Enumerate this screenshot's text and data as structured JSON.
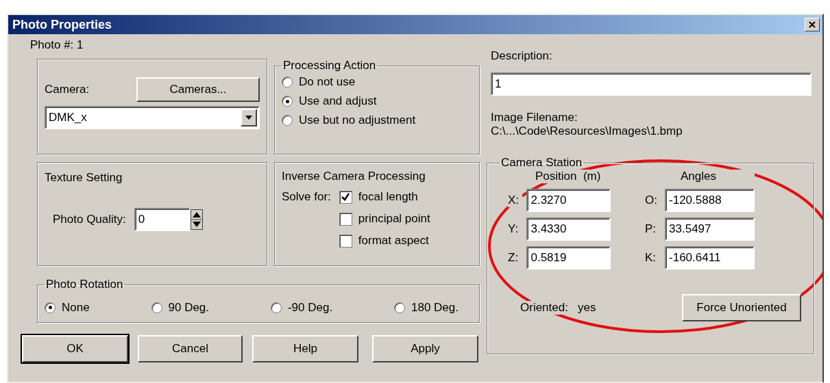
{
  "window": {
    "title": "Photo Properties"
  },
  "photo_number": "Photo #: 1",
  "camera": {
    "label": "Camera:",
    "button": "Cameras...",
    "value": "DMK_x"
  },
  "processing_action": {
    "title": "Processing Action",
    "options": [
      {
        "label": "Do not use",
        "selected": false
      },
      {
        "label": "Use and adjust",
        "selected": true
      },
      {
        "label": "Use but no adjustment",
        "selected": false
      }
    ]
  },
  "texture_setting": {
    "title": "Texture Setting",
    "label": "Photo Quality:",
    "value": "0"
  },
  "inverse_camera_processing": {
    "title": "Inverse Camera Processing",
    "solve_for": "Solve for:",
    "options": [
      {
        "label": "focal length",
        "checked": true
      },
      {
        "label": "principal point",
        "checked": false
      },
      {
        "label": "format aspect",
        "checked": false
      }
    ]
  },
  "photo_rotation": {
    "title": "Photo Rotation",
    "options": [
      {
        "label": "None",
        "selected": true
      },
      {
        "label": "90 Deg.",
        "selected": false
      },
      {
        "label": "-90 Deg.",
        "selected": false
      },
      {
        "label": "180 Deg.",
        "selected": false
      }
    ]
  },
  "buttons": [
    {
      "label": "OK",
      "default": true
    },
    {
      "label": "Cancel",
      "default": false
    },
    {
      "label": "Help",
      "default": false
    },
    {
      "label": "Apply",
      "default": false
    }
  ],
  "description": {
    "label": "Description:",
    "value": "1"
  },
  "image_filename": {
    "label": "Image Filename:",
    "path": "C:\\...\\Code\\Resources\\Images\\1.bmp"
  },
  "camera_station": {
    "title": "Camera Station",
    "position_header": "Position  (m)",
    "angles_header": "Angles",
    "position": [
      {
        "label": "X:",
        "value": "2.3270"
      },
      {
        "label": "Y:",
        "value": "3.4330"
      },
      {
        "label": "Z:",
        "value": "0.5819"
      }
    ],
    "angles": [
      {
        "label": "O:",
        "value": "-120.5888"
      },
      {
        "label": "P:",
        "value": "33.5497"
      },
      {
        "label": "K:",
        "value": "-160.6411"
      }
    ],
    "oriented_label": "Oriented:",
    "oriented_value": "yes",
    "force_button": "Force Unoriented"
  }
}
